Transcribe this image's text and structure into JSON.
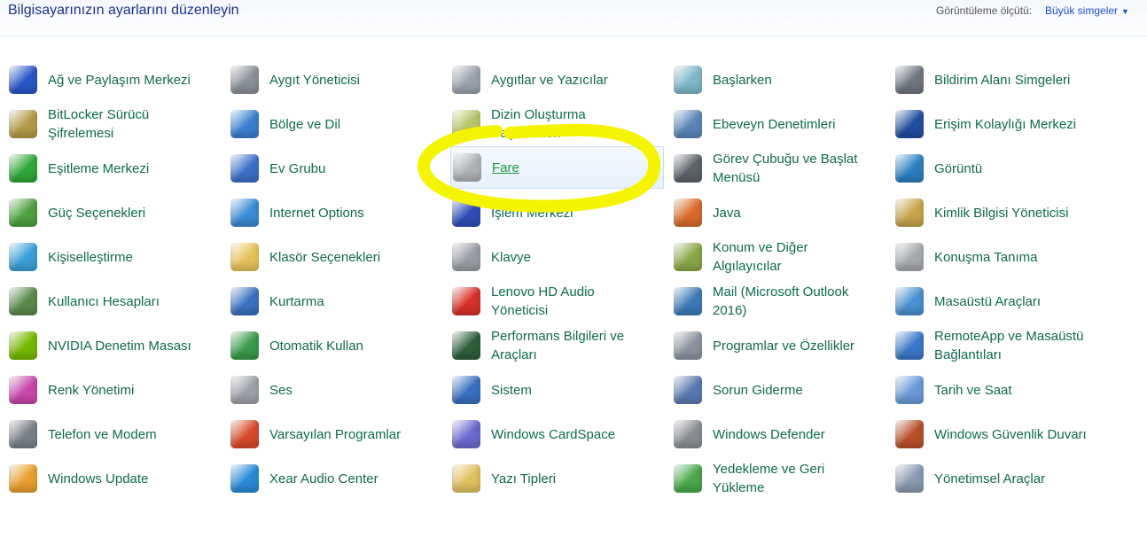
{
  "header": {
    "title": "Bilgisayarınızın ayarlarını düzenleyin",
    "view_by_label": "Görüntüleme ölçütü:",
    "view_by_value": "Büyük simgeler"
  },
  "items": [
    {
      "label": "Ağ ve Paylaşım Merkezi",
      "icon": "network-icon",
      "color": "#2a56c8"
    },
    {
      "label": "Aygıt Yöneticisi",
      "icon": "device-manager-icon",
      "color": "#8a9098"
    },
    {
      "label": "Aygıtlar ve Yazıcılar",
      "icon": "printer-icon",
      "color": "#9aa3ad"
    },
    {
      "label": "Başlarken",
      "icon": "getting-started-icon",
      "color": "#7fb8c9"
    },
    {
      "label": "Bildirim Alanı Simgeleri",
      "icon": "notification-icon",
      "color": "#6f7680"
    },
    {
      "label": "BitLocker Sürücü Şifrelemesi",
      "icon": "bitlocker-icon",
      "color": "#b49a4a"
    },
    {
      "label": "Bölge ve Dil",
      "icon": "globe-clock-icon",
      "color": "#3a7fd0"
    },
    {
      "label": "Dizin Oluşturma Seçenekleri",
      "icon": "indexing-icon",
      "color": "#b8c46a"
    },
    {
      "label": "Ebeveyn Denetimleri",
      "icon": "parental-controls-icon",
      "color": "#5b86b8"
    },
    {
      "label": "Erişim Kolaylığı Merkezi",
      "icon": "ease-of-access-icon",
      "color": "#1f4f9e"
    },
    {
      "label": "Eşitleme Merkezi",
      "icon": "sync-icon",
      "color": "#2fa83a"
    },
    {
      "label": "Ev Grubu",
      "icon": "homegroup-icon",
      "color": "#3d6fc8"
    },
    {
      "label": "Fare",
      "icon": "mouse-icon",
      "color": "#b0b3b8",
      "highlighted": true
    },
    {
      "label": "Görev Çubuğu ve Başlat Menüsü",
      "icon": "taskbar-icon",
      "color": "#5c636b"
    },
    {
      "label": "Görüntü",
      "icon": "display-icon",
      "color": "#2d7fc0"
    },
    {
      "label": "Güç Seçenekleri",
      "icon": "power-icon",
      "color": "#4fa040"
    },
    {
      "label": "Internet Options",
      "icon": "internet-options-icon",
      "color": "#3d8bd4"
    },
    {
      "label": "İşlem Merkezi",
      "icon": "action-center-flag-icon",
      "color": "#2f4fb8"
    },
    {
      "label": "Java",
      "icon": "java-icon",
      "color": "#d86b2a"
    },
    {
      "label": "Kimlik Bilgisi Yöneticisi",
      "icon": "credential-manager-icon",
      "color": "#c8a44a"
    },
    {
      "label": "Kişiselleştirme",
      "icon": "personalization-icon",
      "color": "#3aa0d8"
    },
    {
      "label": "Klasör Seçenekleri",
      "icon": "folder-options-icon",
      "color": "#e6c35a"
    },
    {
      "label": "Klavye",
      "icon": "keyboard-icon",
      "color": "#9a9ea4"
    },
    {
      "label": "Konum ve Diğer Algılayıcılar",
      "icon": "location-sensor-icon",
      "color": "#8aa84a"
    },
    {
      "label": "Konuşma Tanıma",
      "icon": "microphone-icon",
      "color": "#a6a9ae"
    },
    {
      "label": "Kullanıcı Hesapları",
      "icon": "user-accounts-icon",
      "color": "#5a8a4a"
    },
    {
      "label": "Kurtarma",
      "icon": "recovery-icon",
      "color": "#3a72c0"
    },
    {
      "label": "Lenovo HD Audio Yöneticisi",
      "icon": "audio-manager-icon",
      "color": "#d8302a"
    },
    {
      "label": "Mail (Microsoft Outlook 2016)",
      "icon": "mail-icon",
      "color": "#3f7ab8"
    },
    {
      "label": "Masaüstü Araçları",
      "icon": "gadgets-icon",
      "color": "#4a90d0"
    },
    {
      "label": "NVIDIA Denetim Masası",
      "icon": "nvidia-icon",
      "color": "#76b900"
    },
    {
      "label": "Otomatik Kullan",
      "icon": "autoplay-icon",
      "color": "#3a9a4a"
    },
    {
      "label": "Performans Bilgileri ve Araçları",
      "icon": "performance-icon",
      "color": "#2e5e3a"
    },
    {
      "label": "Programlar ve Özellikler",
      "icon": "programs-icon",
      "color": "#8a94a0"
    },
    {
      "label": "RemoteApp ve Masaüstü Bağlantıları",
      "icon": "remoteapp-icon",
      "color": "#3a78c8"
    },
    {
      "label": "Renk Yönetimi",
      "icon": "color-management-icon",
      "color": "#c848a8"
    },
    {
      "label": "Ses",
      "icon": "speaker-icon",
      "color": "#9ea2a8"
    },
    {
      "label": "Sistem",
      "icon": "system-icon",
      "color": "#3a6fc0"
    },
    {
      "label": "Sorun Giderme",
      "icon": "troubleshooting-icon",
      "color": "#5a7ab0"
    },
    {
      "label": "Tarih ve Saat",
      "icon": "date-time-icon",
      "color": "#6a9ad8"
    },
    {
      "label": "Telefon ve Modem",
      "icon": "phone-modem-icon",
      "color": "#7a8088"
    },
    {
      "label": "Varsayılan Programlar",
      "icon": "default-programs-icon",
      "color": "#d84a2a"
    },
    {
      "label": "Windows CardSpace",
      "icon": "cardspace-icon",
      "color": "#6a6ad0"
    },
    {
      "label": "Windows Defender",
      "icon": "defender-icon",
      "color": "#8a8e94"
    },
    {
      "label": "Windows Güvenlik Duvarı",
      "icon": "firewall-icon",
      "color": "#b8502a"
    },
    {
      "label": "Windows Update",
      "icon": "windows-update-icon",
      "color": "#e8a030"
    },
    {
      "label": "Xear Audio Center",
      "icon": "xear-audio-icon",
      "color": "#2a8ad8"
    },
    {
      "label": "Yazı Tipleri",
      "icon": "fonts-icon",
      "color": "#e0c060"
    },
    {
      "label": "Yedekleme ve Geri Yükleme",
      "icon": "backup-restore-icon",
      "color": "#4aa84a"
    },
    {
      "label": "Yönetimsel Araçlar",
      "icon": "admin-tools-icon",
      "color": "#8a9ab0"
    }
  ]
}
